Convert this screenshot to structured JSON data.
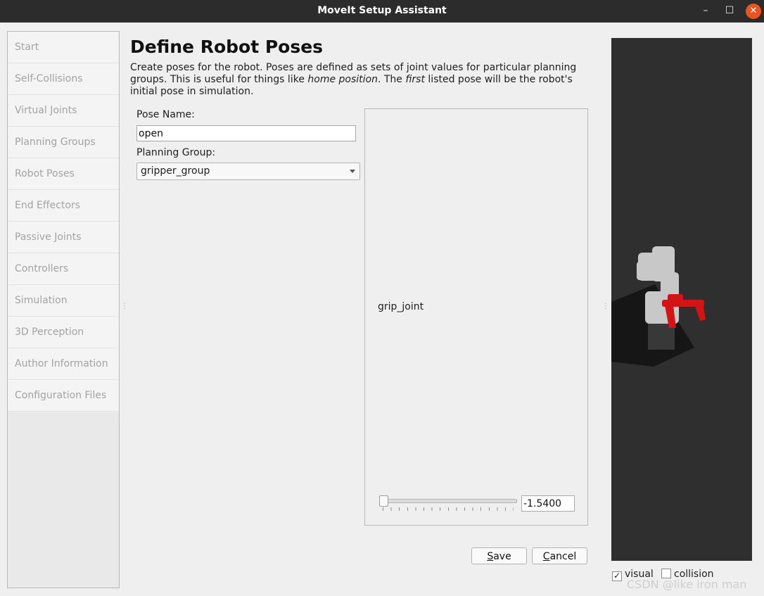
{
  "window": {
    "title": "MoveIt Setup Assistant",
    "minimize_glyph": "–",
    "maximize_glyph": "☐",
    "close_glyph": "✕"
  },
  "nav": {
    "items": [
      {
        "label": "Start"
      },
      {
        "label": "Self-Collisions"
      },
      {
        "label": "Virtual Joints"
      },
      {
        "label": "Planning Groups"
      },
      {
        "label": "Robot Poses"
      },
      {
        "label": "End Effectors"
      },
      {
        "label": "Passive Joints"
      },
      {
        "label": "Controllers"
      },
      {
        "label": "Simulation"
      },
      {
        "label": "3D Perception"
      },
      {
        "label": "Author Information"
      },
      {
        "label": "Configuration Files"
      }
    ]
  },
  "header": {
    "title": "Define Robot Poses",
    "desc_part1": "Create poses for the robot. Poses are defined as sets of joint values for particular planning groups. This is useful for things like ",
    "desc_em1": "home position",
    "desc_part2": ". The ",
    "desc_em2": "first",
    "desc_part3": " listed pose will be the robot's initial pose in simulation."
  },
  "form": {
    "pose_name_label": "Pose Name:",
    "pose_name_value": "open",
    "planning_group_label": "Planning Group:",
    "planning_group_value": "gripper_group"
  },
  "joints": {
    "items": [
      {
        "name": "grip_joint",
        "value_text": "-1.5400",
        "position_fraction": 0.0
      }
    ]
  },
  "buttons": {
    "save_ul": "S",
    "save_rest": "ave",
    "cancel_ul": "C",
    "cancel_rest": "ancel"
  },
  "view": {
    "visual_label": "visual",
    "visual_checked": true,
    "collision_label": "collision",
    "collision_checked": false,
    "robot_color": "#c8c8c8",
    "gripper_color": "#d21414",
    "background_color": "#2f2f2f"
  },
  "watermark": "CSDN @like iron man"
}
